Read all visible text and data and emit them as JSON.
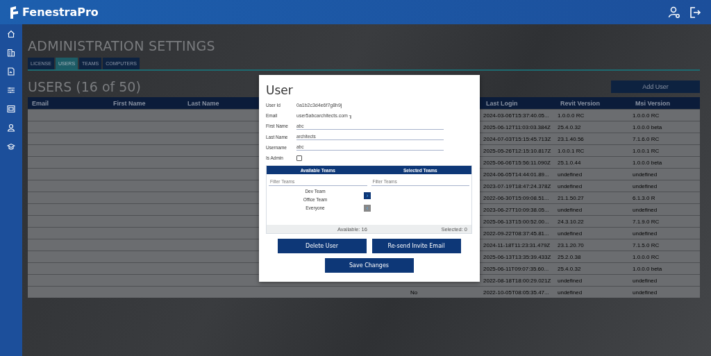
{
  "app": {
    "name": "FenestraPro"
  },
  "sidebar": {
    "items": [
      {
        "kind": "home"
      },
      {
        "kind": "building"
      },
      {
        "kind": "document"
      },
      {
        "kind": "sliders"
      },
      {
        "kind": "grid"
      },
      {
        "kind": "person"
      },
      {
        "kind": "cap"
      }
    ]
  },
  "page": {
    "title": "ADMINISTRATION SETTINGS"
  },
  "tabs": [
    {
      "label": "LICENSE",
      "selected": false
    },
    {
      "label": "USERS",
      "selected": true
    },
    {
      "label": "TEAMS",
      "selected": false
    },
    {
      "label": "COMPUTERS",
      "selected": false
    }
  ],
  "users": {
    "heading": "USERS (16 of 50)",
    "add_button": "Add User",
    "columns": [
      "Email",
      "First Name",
      "Last Name",
      "Last Login",
      "Revit Version",
      "Msi Version"
    ],
    "rows": [
      {
        "last_login": "2024-03-06T15:37:40.05...",
        "revit": "1.0.0.0 RC",
        "msi": "1.0.0.0 RC"
      },
      {
        "last_login": "2025-06-12T11:03:03.384Z",
        "revit": "25.4.0.32",
        "msi": "1.0.0.0 beta"
      },
      {
        "last_login": "2024-07-03T15:15:45.713Z",
        "revit": "23.1.40.56",
        "msi": "7.1.6.0 RC"
      },
      {
        "last_login": "2025-05-26T12:15:10.817Z",
        "revit": "1.0.0.1 RC",
        "msi": "1.0.0.1 RC"
      },
      {
        "last_login": "2025-06-06T15:56:11.090Z",
        "revit": "25.1.0.44",
        "msi": "1.0.0.0 beta"
      },
      {
        "last_login": "2024-06-05T14:44:01.89...",
        "revit": "undefined",
        "msi": "undefined"
      },
      {
        "last_login": "2023-07-19T18:47:24.378Z",
        "revit": "undefined",
        "msi": "undefined"
      },
      {
        "last_login": "2022-06-30T15:09:08.51...",
        "revit": "21.1.50.27",
        "msi": "6.1.3.0 R"
      },
      {
        "last_login": "2023-06-27T10:09:38.05...",
        "revit": "undefined",
        "msi": "undefined"
      },
      {
        "last_login": "2025-06-13T15:00:52.00...",
        "revit": "24.3.10.22",
        "msi": "7.1.9.0 RC"
      },
      {
        "last_login": "2022-09-22T08:37:45.81...",
        "revit": "undefined",
        "msi": "undefined"
      },
      {
        "last_login": "2024-11-18T11:23:31.479Z",
        "revit": "23.1.20.70",
        "msi": "7.1.5.0 RC"
      },
      {
        "last_login": "2025-06-13T13:35:39.433Z",
        "revit": "25.2.0.38",
        "msi": "1.0.0.0 RC"
      },
      {
        "last_login": "2025-06-11T09:07:35.60...",
        "revit": "25.4.0.32",
        "msi": "1.0.0.0 beta"
      },
      {
        "last_login": "2022-08-18T18:00:29.021Z",
        "revit": "undefined",
        "msi": "undefined"
      },
      {
        "flag": "No",
        "last_login": "2022-10-05T08:05:35.47...",
        "revit": "undefined",
        "msi": "undefined"
      }
    ]
  },
  "dialog": {
    "title": "User",
    "info": [
      {
        "label": "User Id",
        "value": "0a1b2c3d4e6f7g8h9j"
      },
      {
        "label": "Email",
        "value": "user5abcarchitects.com ╖"
      }
    ],
    "fields": [
      {
        "label": "First Name",
        "value": "abc"
      },
      {
        "label": "Last Name",
        "value": "architects"
      },
      {
        "label": "Username",
        "value": "abc"
      }
    ],
    "is_admin": {
      "label": "Is Admin",
      "checked": false
    },
    "teams": {
      "available_header": "Available Teams",
      "selected_header": "Selected Teams",
      "available_filter": {
        "placeholder": "Filter Teams"
      },
      "selected_filter": {
        "placeholder": "Filter Teams"
      },
      "available": [
        "Dev Team",
        "Office Team",
        "Everyone"
      ],
      "move_right": {
        "label": "›",
        "disabled": false
      },
      "move_left": {
        "label": "‹",
        "disabled": true
      },
      "available_count": "Available: 16",
      "selected_count": "Selected: 0"
    },
    "buttons": [
      "Delete User",
      "Re-send Invite Email"
    ],
    "save": "Save Changes"
  }
}
